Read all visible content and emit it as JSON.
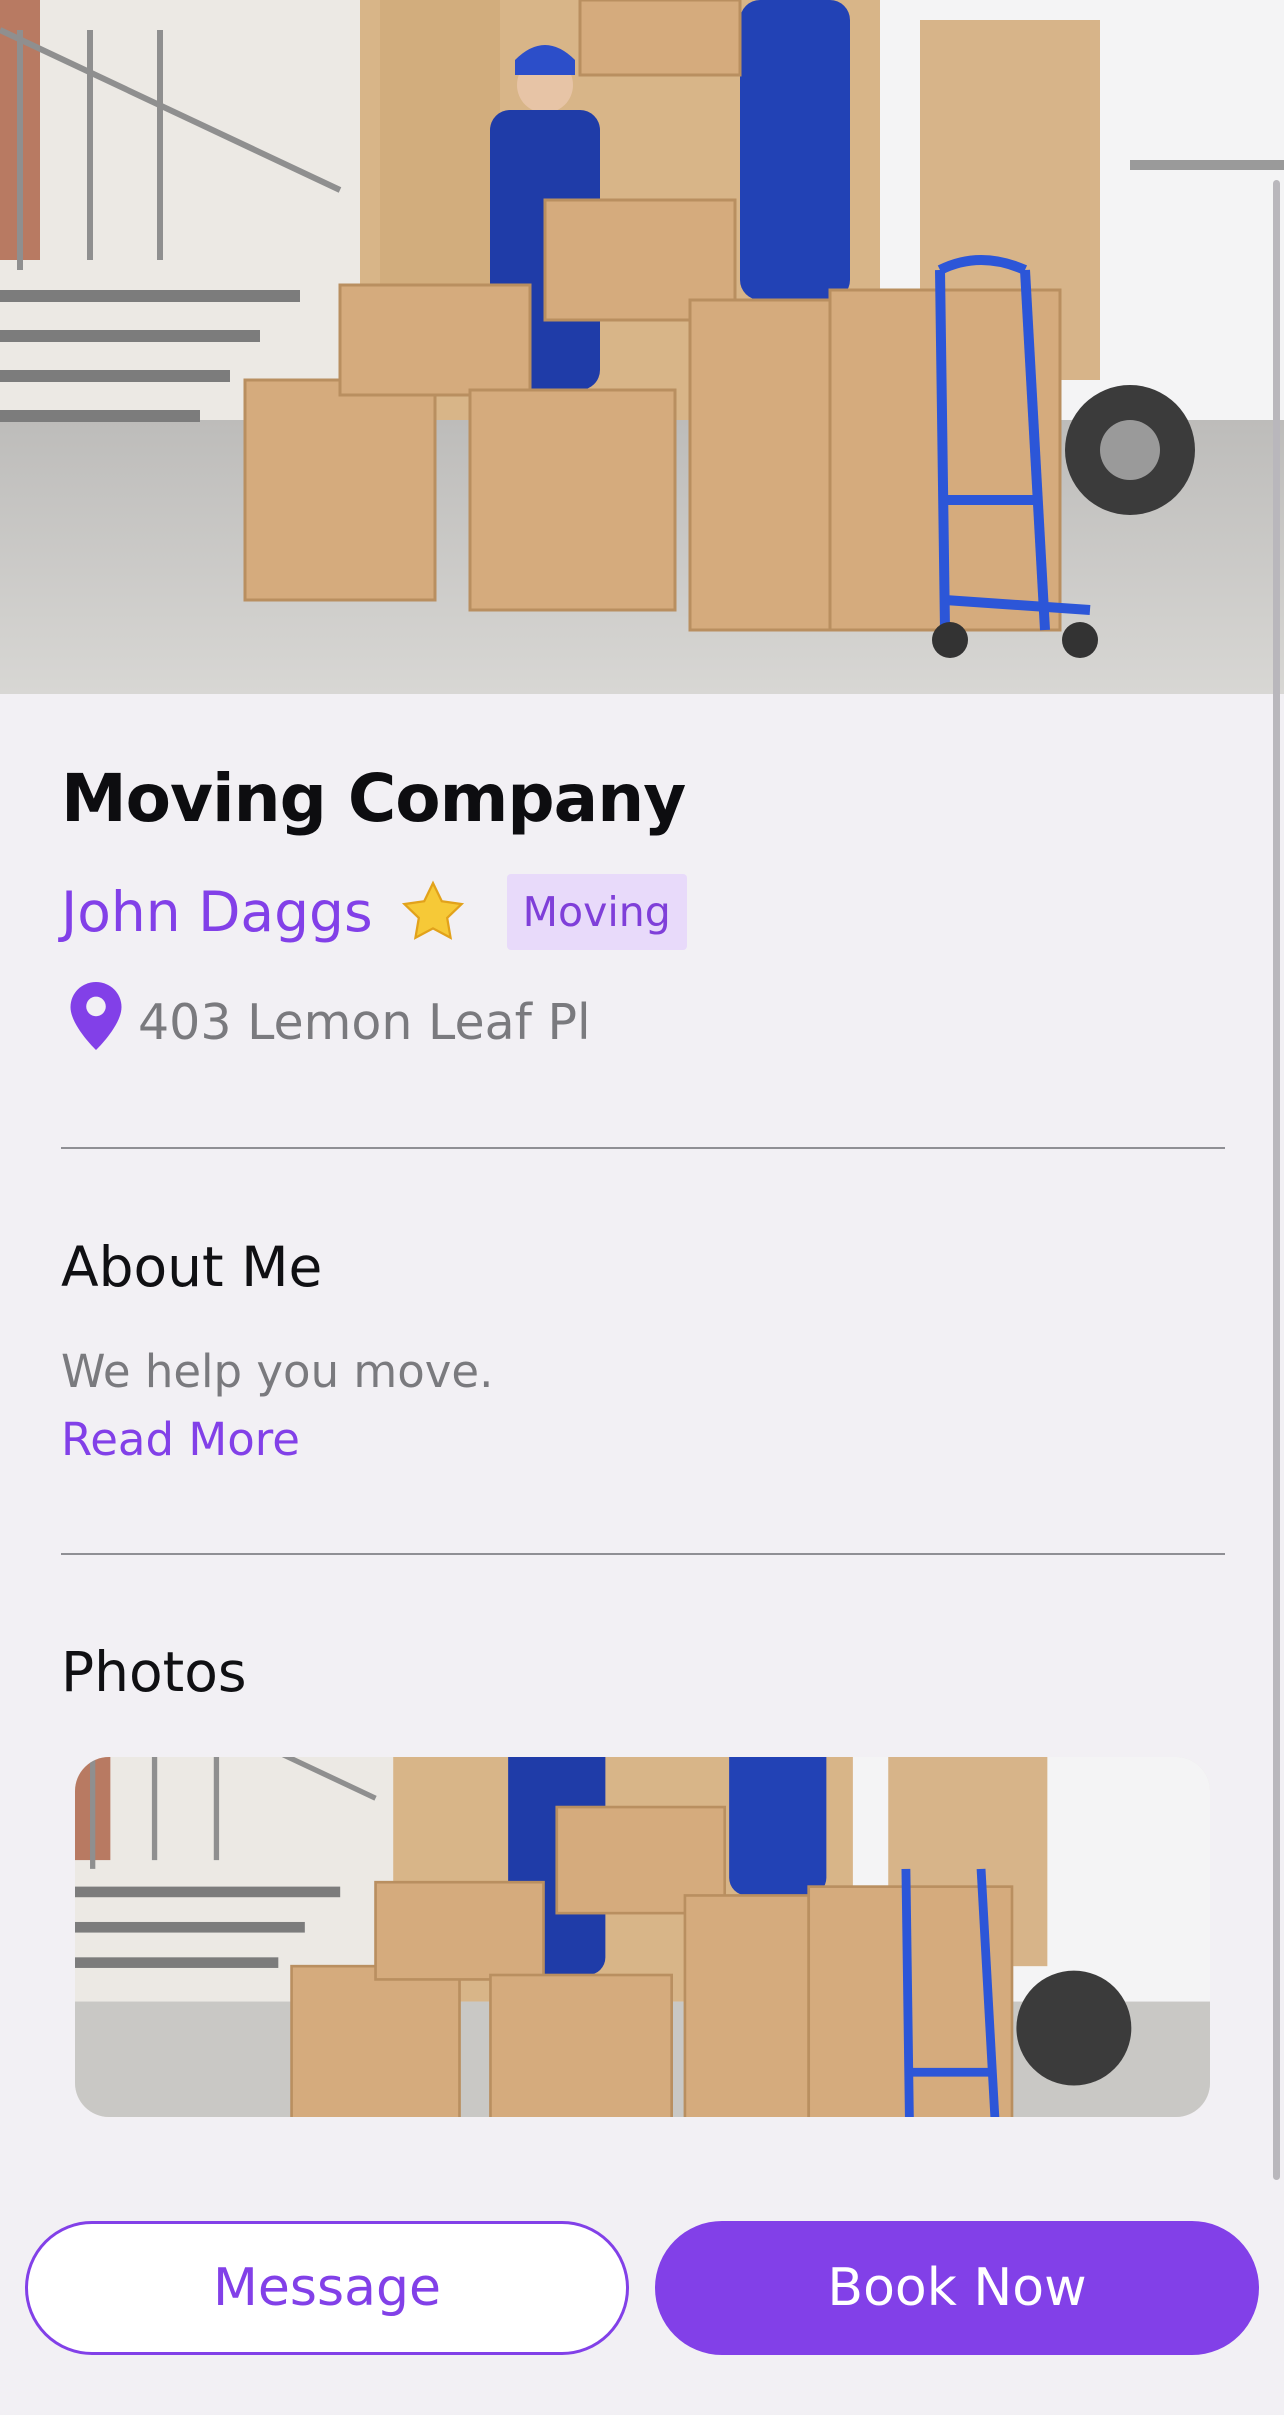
{
  "business": {
    "title": "Moving Company",
    "owner": "John Daggs",
    "category": "Moving",
    "address": "403 Lemon Leaf Pl"
  },
  "about": {
    "heading": "About Me",
    "text": "We help you move.",
    "read_more": "Read More"
  },
  "photos": {
    "heading": "Photos"
  },
  "actions": {
    "message_label": "Message",
    "book_label": "Book Now"
  },
  "colors": {
    "accent": "#8240e8",
    "background": "#f2f0f4",
    "badge_bg": "#e8dafa"
  },
  "icons": {
    "rating": "star-icon",
    "location": "map-pin-icon"
  }
}
